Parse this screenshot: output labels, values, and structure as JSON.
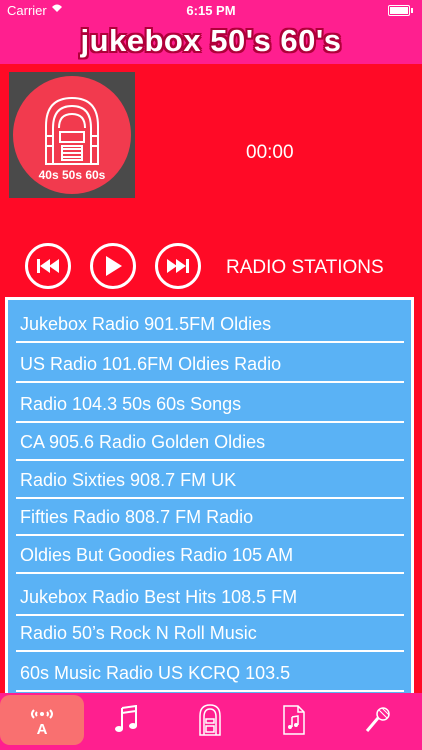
{
  "status_bar": {
    "carrier": "Carrier",
    "wifi_icon": "wifi-icon",
    "time": "6:15 PM",
    "battery_icon": "battery-icon"
  },
  "header": {
    "title": "jukebox 50's 60's"
  },
  "player": {
    "logo_caption": "40s 50s 60s",
    "elapsed": "00:00",
    "controls": [
      "previous-button",
      "play-button",
      "next-button"
    ],
    "stations_label": "RADIO STATIONS"
  },
  "stations": [
    {
      "name": "Jukebox Radio 901.5FM Oldies"
    },
    {
      "name": "US Radio 101.6FM Oldies Radio"
    },
    {
      "name": "Radio 104.3 50s 60s Songs"
    },
    {
      "name": "CA 905.6 Radio Golden Oldies"
    },
    {
      "name": "Radio Sixties 908.7 FM UK"
    },
    {
      "name": "Fifties Radio 808.7 FM Radio"
    },
    {
      "name": "Oldies But Goodies Radio 105 AM"
    },
    {
      "name": "Jukebox Radio Best Hits 108.5 FM"
    },
    {
      "name": "Radio 50’s Rock N Roll Music"
    },
    {
      "name": "60s Music Radio US KCRQ 103.5"
    }
  ],
  "tab_bar": {
    "tabs": [
      {
        "icon": "radio-antenna-icon",
        "active": true
      },
      {
        "icon": "music-note-icon",
        "active": false
      },
      {
        "icon": "jukebox-icon",
        "active": false
      },
      {
        "icon": "music-document-icon",
        "active": false
      },
      {
        "icon": "microphone-icon",
        "active": false
      }
    ]
  },
  "colors": {
    "background": "#FF0A26",
    "bars": "#FF1F8F",
    "list": "#5AB2F5",
    "active_tab": "#F97070"
  }
}
